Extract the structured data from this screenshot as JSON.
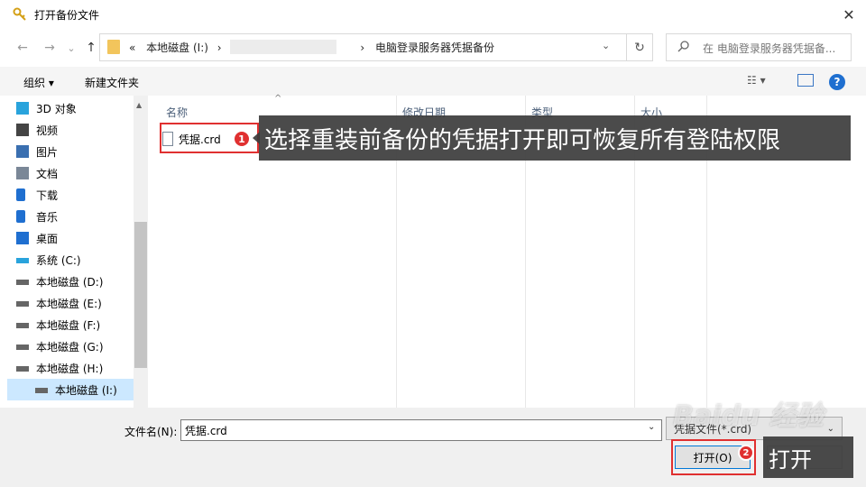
{
  "window": {
    "title": "打开备份文件",
    "close_glyph": "✕"
  },
  "nav": {
    "back_glyph": "←",
    "forward_glyph": "→",
    "recent_glyph": "⌄",
    "up_glyph": "↑",
    "breadcrumb_prefix": "«",
    "breadcrumb_drive": "本地磁盘 (I:)",
    "breadcrumb_sep": "›",
    "breadcrumb_folder": "电脑登录服务器凭据备份",
    "dropdown_glyph": "⌄",
    "refresh_glyph": "↻",
    "search_placeholder": "在 电脑登录服务器凭据备..."
  },
  "toolbar": {
    "organize_label": "组织 ▾",
    "new_folder_label": "新建文件夹",
    "view_glyph": "☷ ▾",
    "help_glyph": "?"
  },
  "sidebar": {
    "items": [
      {
        "label": "3D 对象",
        "icon": "3d-objects-icon",
        "color": "#29a3dc"
      },
      {
        "label": "视频",
        "icon": "video-icon",
        "color": "#444444"
      },
      {
        "label": "图片",
        "icon": "pictures-icon",
        "color": "#3a6fb0"
      },
      {
        "label": "文档",
        "icon": "document-icon",
        "color": "#7a8797"
      },
      {
        "label": "下载",
        "icon": "download-icon",
        "color": "#1f6fd0"
      },
      {
        "label": "音乐",
        "icon": "music-icon",
        "color": "#1f6fd0"
      },
      {
        "label": "桌面",
        "icon": "desktop-icon",
        "color": "#1f6fd0"
      },
      {
        "label": "系统 (C:)",
        "icon": "system-drive-icon",
        "color": "#29a3dc"
      },
      {
        "label": "本地磁盘 (D:)",
        "icon": "drive-icon",
        "color": "#666666"
      },
      {
        "label": "本地磁盘 (E:)",
        "icon": "drive-icon",
        "color": "#666666"
      },
      {
        "label": "本地磁盘 (F:)",
        "icon": "drive-icon",
        "color": "#666666"
      },
      {
        "label": "本地磁盘 (G:)",
        "icon": "drive-icon",
        "color": "#666666"
      },
      {
        "label": "本地磁盘 (H:)",
        "icon": "drive-icon",
        "color": "#666666"
      },
      {
        "label": "本地磁盘 (I:)",
        "icon": "drive-icon",
        "color": "#666666",
        "selected": true
      }
    ]
  },
  "filelist": {
    "columns": [
      "名称",
      "修改日期",
      "类型",
      "大小"
    ],
    "sort_glyph": "^",
    "files": [
      {
        "name": "凭据.crd"
      }
    ]
  },
  "annotations": {
    "step1_number": "1",
    "step1_text": "选择重装前备份的凭据打开即可恢复所有登陆权限",
    "step2_number": "2",
    "step2_text": "打开"
  },
  "footer": {
    "filename_label": "文件名(N):",
    "filename_value": "凭据.crd",
    "filter_value": "凭据文件(*.crd)",
    "open_label": "打开(O)"
  },
  "colors": {
    "accent": "#0078d7",
    "annotation_red": "#e03030",
    "callout_bg": "#3c3c3c"
  }
}
